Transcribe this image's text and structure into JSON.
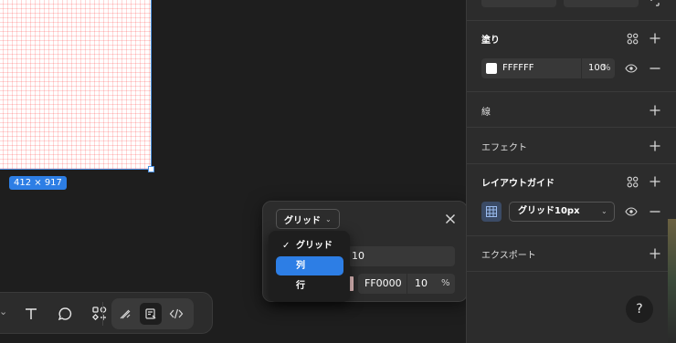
{
  "canvas": {
    "frame_size_label": "412 × 917"
  },
  "toolbar": {
    "chevron": "⌄",
    "tools": [
      "text-tool",
      "comment-tool",
      "components-tool",
      "draw-mode",
      "design-mode",
      "dev-mode"
    ]
  },
  "grid_popover": {
    "type_select_label": "グリッド",
    "count_value": "10",
    "color_hex": "FF0000",
    "color_opacity": "10",
    "opacity_unit": "%",
    "menu": {
      "items": [
        {
          "label": "グリッド",
          "checked": true
        },
        {
          "label": "列",
          "selected": true
        },
        {
          "label": "行"
        }
      ],
      "check_glyph": "✓"
    }
  },
  "panel": {
    "fill": {
      "title": "塗り",
      "color_hex": "FFFFFF",
      "opacity": "100",
      "opacity_unit": "%"
    },
    "stroke": {
      "title": "線"
    },
    "effects": {
      "title": "エフェクト"
    },
    "layout_guide": {
      "title": "レイアウトガイド",
      "grid_select_label": "グリッド10px"
    },
    "export": {
      "title": "エクスポート"
    },
    "help_label": "?"
  },
  "colors": {
    "accent": "#2d7ee5",
    "panel_bg": "#2c2c2c",
    "canvas_bg": "#1e1e1e",
    "grid_line": "#ff0000"
  }
}
